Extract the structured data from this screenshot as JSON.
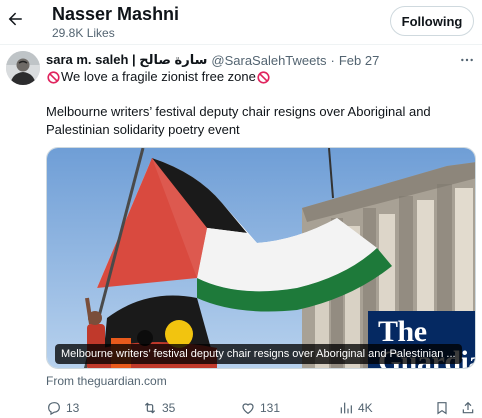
{
  "header": {
    "title": "Nasser Mashni",
    "subtitle": "29.8K Likes",
    "follow_label": "Following"
  },
  "tweet": {
    "author_name": "sara m. saleh | سارة صالح",
    "handle": "@SaraSalehTweets",
    "separator": "·",
    "date": "Feb 27",
    "line1_text": "We love a fragile zionist free zone",
    "body": "Melbourne writers’ festival deputy chair resigns over Aboriginal and Palestinian solidarity poetry event"
  },
  "card": {
    "caption": "Melbourne writers’ festival deputy chair resigns over Aboriginal and Palestinian ...",
    "logo_text": "The Guardian",
    "source": "From theguardian.com"
  },
  "actions": {
    "replies": "13",
    "retweets": "35",
    "likes": "131",
    "views": "4K"
  },
  "colors": {
    "text_primary": "#0f1419",
    "text_secondary": "#536471",
    "flag_red": "#e03131",
    "flag_green": "#1e7a3a",
    "guardian_blue": "#052962",
    "no_sign_red": "#e0245e"
  },
  "icons": [
    "back-arrow-icon",
    "more-icon",
    "no-entry-icon",
    "reply-icon",
    "retweet-icon",
    "like-icon",
    "views-icon",
    "bookmark-icon",
    "share-icon"
  ]
}
